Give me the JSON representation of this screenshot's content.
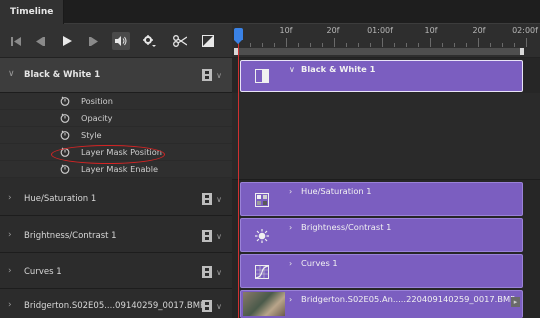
{
  "panel": {
    "tab_label": "Timeline"
  },
  "toolbar": {
    "buttons": [
      "go-to-first-frame",
      "previous-frame",
      "play",
      "next-frame",
      "audio",
      "settings",
      "split-at-playhead",
      "transition"
    ]
  },
  "ruler": {
    "tick_labels": [
      "10f",
      "20f",
      "01:00f",
      "10f",
      "20f",
      "02:00f"
    ]
  },
  "layers": [
    {
      "name": "Black & White 1",
      "expanded": true,
      "clip_label": "Black & White 1",
      "properties": [
        "Position",
        "Opacity",
        "Style",
        "Layer Mask Position",
        "Layer Mask Enable"
      ],
      "highlighted_property": "Layer Mask Position"
    },
    {
      "name": "Hue/Saturation 1",
      "expanded": false,
      "clip_label": "Hue/Saturation 1"
    },
    {
      "name": "Brightness/Contrast 1",
      "expanded": false,
      "clip_label": "Brightness/Contrast 1"
    },
    {
      "name": "Curves 1",
      "expanded": false,
      "clip_label": "Curves 1"
    },
    {
      "name": "Bridgerton.S02E05....09140259_0017.BMP",
      "expanded": false,
      "clip_label": "Bridgerton.S02E05.An.....220409140259_0017.BMP"
    }
  ],
  "colors": {
    "clip": "#7b5ec0",
    "playhead": "#3a82e6",
    "playhead_line": "#d03030",
    "annotation": "#d42424"
  }
}
